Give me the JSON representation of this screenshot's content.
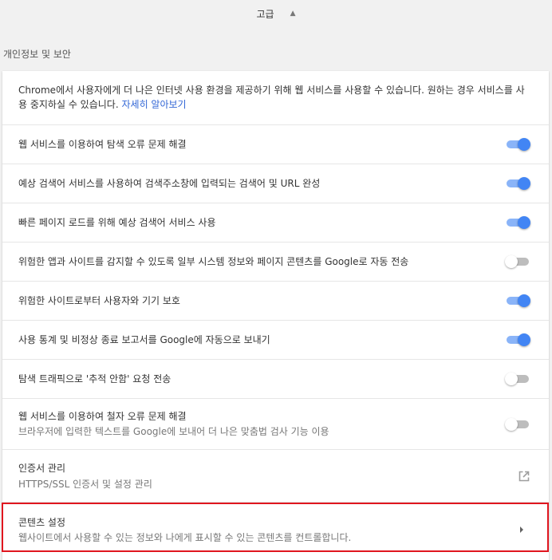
{
  "advanced": {
    "label": "고급",
    "caret": "▲"
  },
  "section": {
    "title": "개인정보 및 보안"
  },
  "intro": {
    "text": "Chrome에서 사용자에게 더 나은 인터넷 사용 환경을 제공하기 위해 웹 서비스를 사용할 수 있습니다. 원하는 경우 서비스를 사용 중지하실 수 있습니다. ",
    "link": "자세히 알아보기"
  },
  "rows": [
    {
      "label": "웹 서비스를 이용하여 탐색 오류 문제 해결",
      "toggle": "on"
    },
    {
      "label": "예상 검색어 서비스를 사용하여 검색주소창에 입력되는 검색어 및 URL 완성",
      "toggle": "on"
    },
    {
      "label": "빠른 페이지 로드를 위해 예상 검색어 서비스 사용",
      "toggle": "on"
    },
    {
      "label": "위험한 앱과 사이트를 감지할 수 있도록 일부 시스템 정보와 페이지 콘텐츠를 Google로 자동 전송",
      "toggle": "off"
    },
    {
      "label": "위험한 사이트로부터 사용자와 기기 보호",
      "toggle": "on"
    },
    {
      "label": "사용 통계 및 비정상 종료 보고서를 Google에 자동으로 보내기",
      "toggle": "on"
    },
    {
      "label": "탐색 트래픽으로 '추적 안함' 요청 전송",
      "toggle": "off"
    },
    {
      "label": "웹 서비스를 이용하여 철자 오류 문제 해결",
      "sublabel": "브라우저에 입력한 텍스트를 Google에 보내어 더 나은 맞춤법 검사 기능 이용",
      "toggle": "off"
    }
  ],
  "certificates": {
    "label": "인증서 관리",
    "sublabel": "HTTPS/SSL 인증서 및 설정 관리",
    "icon": "external-link-icon"
  },
  "content_settings": {
    "label": "콘텐츠 설정",
    "sublabel": "웹사이트에서 사용할 수 있는 정보와 나에게 표시할 수 있는 콘텐츠를 컨트롤합니다.",
    "icon": "arrow-right-icon"
  },
  "colors": {
    "toggle_on_knob": "#4285f4",
    "toggle_on_track": "#8ab4f8",
    "toggle_off_track": "#bdbdbd",
    "link": "#3367d6",
    "highlight": "#e0161f"
  }
}
